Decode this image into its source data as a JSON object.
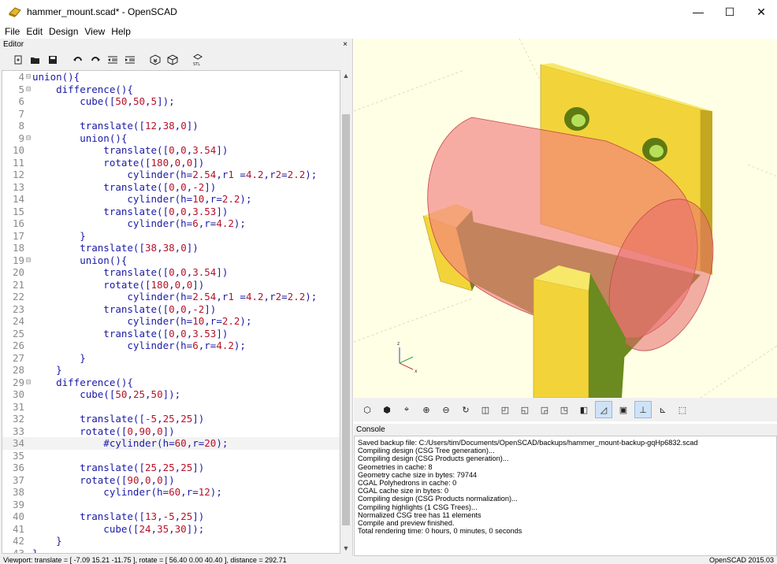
{
  "window": {
    "title": "hammer_mount.scad* - OpenSCAD",
    "minimize": "—",
    "maximize": "☐",
    "close": "✕"
  },
  "menu": [
    "File",
    "Edit",
    "Design",
    "View",
    "Help"
  ],
  "editor": {
    "title": "Editor",
    "close": "×",
    "toolbar": [
      "new-icon",
      "open-icon",
      "save-icon",
      "undo-icon",
      "redo-icon",
      "unindent-icon",
      "indent-icon",
      "preview-icon",
      "render-icon",
      "export-stl-icon"
    ],
    "current_line": 34,
    "lines": [
      {
        "n": "4",
        "f": "⊟",
        "t": "union(){"
      },
      {
        "n": "5",
        "f": "⊟",
        "t": "    difference(){"
      },
      {
        "n": "6",
        "f": "",
        "t": "        cube([50,50,5]);"
      },
      {
        "n": "7",
        "f": "",
        "t": ""
      },
      {
        "n": "8",
        "f": "",
        "t": "        translate([12,38,0])"
      },
      {
        "n": "9",
        "f": "⊟",
        "t": "        union(){"
      },
      {
        "n": "10",
        "f": "",
        "t": "            translate([0,0,3.54])"
      },
      {
        "n": "11",
        "f": "",
        "t": "            rotate([180,0,0])"
      },
      {
        "n": "12",
        "f": "",
        "t": "                cylinder(h=2.54,r1 =4.2,r2=2.2);"
      },
      {
        "n": "13",
        "f": "",
        "t": "            translate([0,0,-2])"
      },
      {
        "n": "14",
        "f": "",
        "t": "                cylinder(h=10,r=2.2);"
      },
      {
        "n": "15",
        "f": "",
        "t": "            translate([0,0,3.53])"
      },
      {
        "n": "16",
        "f": "",
        "t": "                cylinder(h=6,r=4.2);"
      },
      {
        "n": "17",
        "f": "",
        "t": "        }"
      },
      {
        "n": "18",
        "f": "",
        "t": "        translate([38,38,0])"
      },
      {
        "n": "19",
        "f": "⊟",
        "t": "        union(){"
      },
      {
        "n": "20",
        "f": "",
        "t": "            translate([0,0,3.54])"
      },
      {
        "n": "21",
        "f": "",
        "t": "            rotate([180,0,0])"
      },
      {
        "n": "22",
        "f": "",
        "t": "                cylinder(h=2.54,r1 =4.2,r2=2.2);"
      },
      {
        "n": "23",
        "f": "",
        "t": "            translate([0,0,-2])"
      },
      {
        "n": "24",
        "f": "",
        "t": "                cylinder(h=10,r=2.2);"
      },
      {
        "n": "25",
        "f": "",
        "t": "            translate([0,0,3.53])"
      },
      {
        "n": "26",
        "f": "",
        "t": "                cylinder(h=6,r=4.2);"
      },
      {
        "n": "27",
        "f": "",
        "t": "        }"
      },
      {
        "n": "28",
        "f": "",
        "t": "    }"
      },
      {
        "n": "29",
        "f": "⊟",
        "t": "    difference(){"
      },
      {
        "n": "30",
        "f": "",
        "t": "        cube([50,25,50]);"
      },
      {
        "n": "31",
        "f": "",
        "t": ""
      },
      {
        "n": "32",
        "f": "",
        "t": "        translate([-5,25,25])"
      },
      {
        "n": "33",
        "f": "",
        "t": "        rotate([0,90,0])"
      },
      {
        "n": "34",
        "f": "",
        "t": "            #cylinder(h=60,r=20);"
      },
      {
        "n": "35",
        "f": "",
        "t": ""
      },
      {
        "n": "36",
        "f": "",
        "t": "        translate([25,25,25])"
      },
      {
        "n": "37",
        "f": "",
        "t": "        rotate([90,0,0])"
      },
      {
        "n": "38",
        "f": "",
        "t": "            cylinder(h=60,r=12);"
      },
      {
        "n": "39",
        "f": "",
        "t": ""
      },
      {
        "n": "40",
        "f": "",
        "t": "        translate([13,-5,25])"
      },
      {
        "n": "41",
        "f": "",
        "t": "            cube([24,35,30]);"
      },
      {
        "n": "42",
        "f": "",
        "t": "    }"
      },
      {
        "n": "43",
        "f": "",
        "t": "}"
      }
    ]
  },
  "viewport": {
    "background": "#ffffe6",
    "model_color": "#f2d43a",
    "model_shadow": "#6b8a1f",
    "highlight_color": "#f28080",
    "axis_labels": [
      "z",
      "x"
    ]
  },
  "view_toolbar": [
    "render-icon",
    "preview-icon",
    "view-all-icon",
    "zoom-in-icon",
    "zoom-out-icon",
    "reset-view-icon",
    "right-view-icon",
    "top-view-icon",
    "bottom-view-icon",
    "left-view-icon",
    "front-view-icon",
    "back-view-icon",
    "perspective-icon",
    "orthogonal-icon",
    "show-axes-icon",
    "show-scale-icon",
    "show-edges-icon"
  ],
  "console": {
    "title": "Console",
    "lines": [
      "Saved backup file: C:/Users/tim/Documents/OpenSCAD/backups/hammer_mount-backup-gqHp6832.scad",
      "Compiling design (CSG Tree generation)...",
      "Compiling design (CSG Products generation)...",
      "Geometries in cache: 8",
      "Geometry cache size in bytes: 79744",
      "CGAL Polyhedrons in cache: 0",
      "CGAL cache size in bytes: 0",
      "Compiling design (CSG Products normalization)...",
      "Compiling highlights (1 CSG Trees)...",
      "Normalized CSG tree has 11 elements",
      "Compile and preview finished.",
      "Total rendering time: 0 hours, 0 minutes, 0 seconds"
    ]
  },
  "status": {
    "viewport": "Viewport: translate = [ -7.09 15.21 -11.75 ], rotate = [ 56.40 0.00 40.40 ], distance = 292.71",
    "version": "OpenSCAD 2015.03"
  }
}
